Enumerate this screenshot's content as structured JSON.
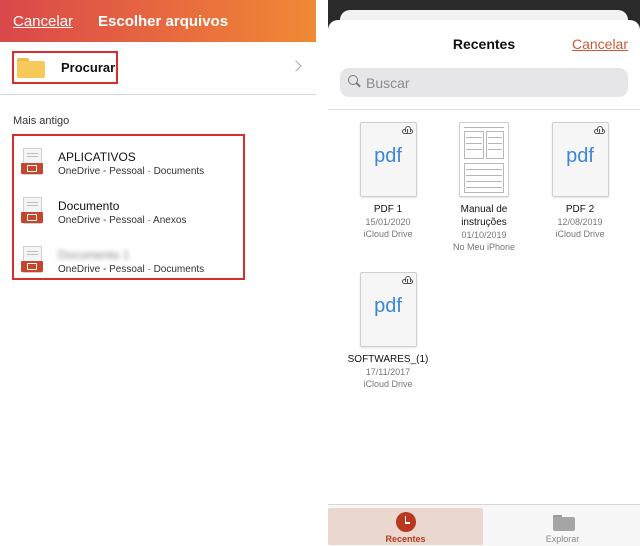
{
  "left_pane": {
    "header": {
      "cancel_label": "Cancelar",
      "title": "Escolher arquivos",
      "gradient_colors": [
        "#d9484a",
        "#ef8a35"
      ]
    },
    "browse": {
      "label": "Procurar",
      "icon": "folder-icon"
    },
    "section_label": "Mais antigo",
    "files": [
      {
        "name": "APLICATIVOS",
        "location": "OneDrive - Pessoal · Documents",
        "icon": "ppt-document-icon"
      },
      {
        "name": "Documento",
        "location": "OneDrive - Pessoal · Anexos",
        "icon": "ppt-document-icon"
      },
      {
        "name": "Documento 1",
        "location": "OneDrive - Pessoal · Documents",
        "icon": "ppt-document-icon"
      }
    ],
    "highlight_color": "#d92c2c"
  },
  "right_pane": {
    "title": "Recentes",
    "cancel_label": "Cancelar",
    "search_placeholder": "Buscar",
    "files": [
      {
        "name": "PDF 1",
        "date": "15/01/2020",
        "location": "iCloud Drive",
        "thumb": "pdf",
        "thumb_text": "pdf"
      },
      {
        "name": "Manual de instruções",
        "date": "01/10/2019",
        "location": "No Meu iPhone",
        "thumb": "document"
      },
      {
        "name": "PDF 2",
        "date": "12/08/2019",
        "location": "iCloud Drive",
        "thumb": "pdf",
        "thumb_text": "pdf"
      },
      {
        "name": "SOFTWARES_(1)",
        "date": "17/11/2017",
        "location": "iCloud Drive",
        "thumb": "pdf",
        "thumb_text": "pdf"
      }
    ],
    "tabs": [
      {
        "label": "Recentes",
        "icon": "clock-icon",
        "active": true
      },
      {
        "label": "Explorar",
        "icon": "folder-icon",
        "active": false
      }
    ],
    "accent_color": "#b9381f"
  }
}
